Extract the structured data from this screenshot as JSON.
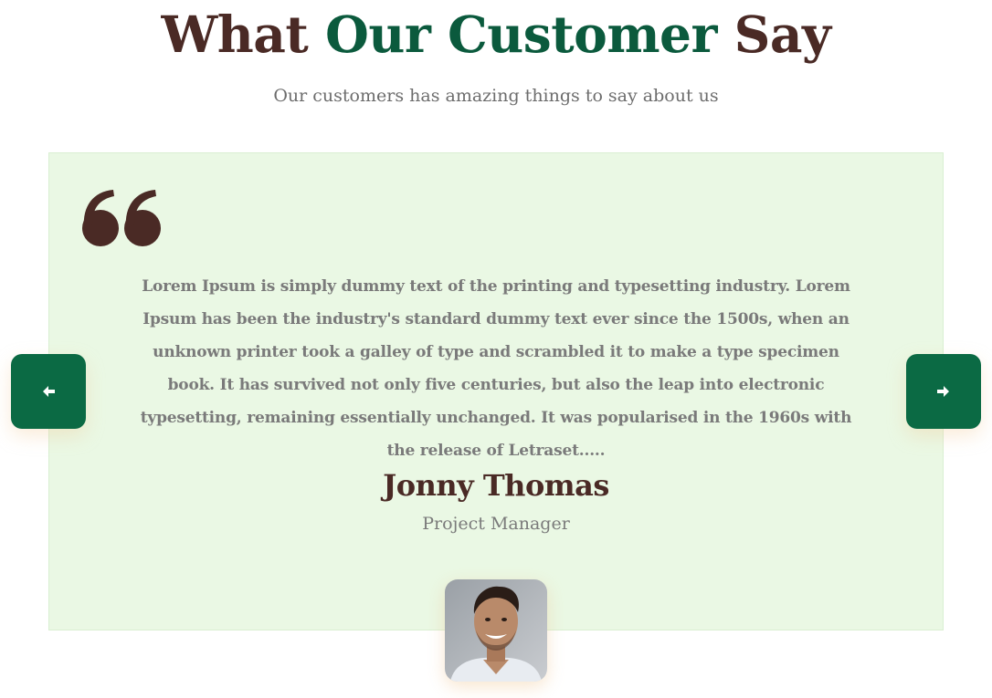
{
  "section": {
    "title_part1": "What",
    "title_part2": "Our Customer",
    "title_part3": "Say",
    "subtitle": "Our customers has amazing things to say about us"
  },
  "testimonial": {
    "text": "Lorem Ipsum is simply dummy text of the printing and typesetting industry. Lorem Ipsum has been the industry's standard dummy text ever since the 1500s, when an unknown printer took a galley of type and scrambled it to make a type specimen book. It has survived not only five centuries, but also the leap into electronic typesetting, remaining essentially unchanged. It was popularised in the 1960s with the release of Letraset.....",
    "author_name": "Jonny Thomas",
    "author_role": "Project Manager",
    "quote_icon": "quote-mark-icon",
    "avatar_icon": "avatar-photo"
  },
  "navigation": {
    "prev_icon": "arrow-left-icon",
    "next_icon": "arrow-right-icon"
  },
  "colors": {
    "heading_dark": "#4a2a25",
    "heading_accent": "#0b5a3d",
    "card_background": "#eaf8e4",
    "nav_button": "#0b6a44",
    "body_text": "#7a7a7a"
  }
}
